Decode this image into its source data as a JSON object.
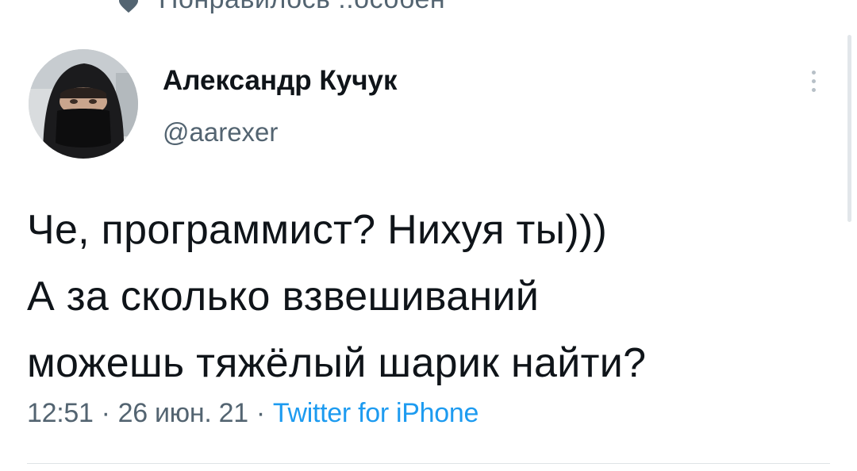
{
  "social_context": {
    "icon": "heart-icon",
    "text": "Понравилось ..особен"
  },
  "tweet": {
    "author": {
      "display_name": "Александр Кучук",
      "handle": "@aarexer",
      "avatar": "avatar-photo"
    },
    "more_icon": "more-vertical-icon",
    "text_lines": [
      "Че, программист? Нихуя ты)))",
      "А за сколько взвешиваний",
      "можешь тяжёлый шарик найти?"
    ],
    "time": "12:51",
    "separator": "·",
    "date": "26 июн. 21",
    "source": "Twitter for iPhone"
  },
  "colors": {
    "text": "#0f1419",
    "secondary": "#536471",
    "link": "#1d9bf0",
    "divider": "#dfe3e6"
  }
}
